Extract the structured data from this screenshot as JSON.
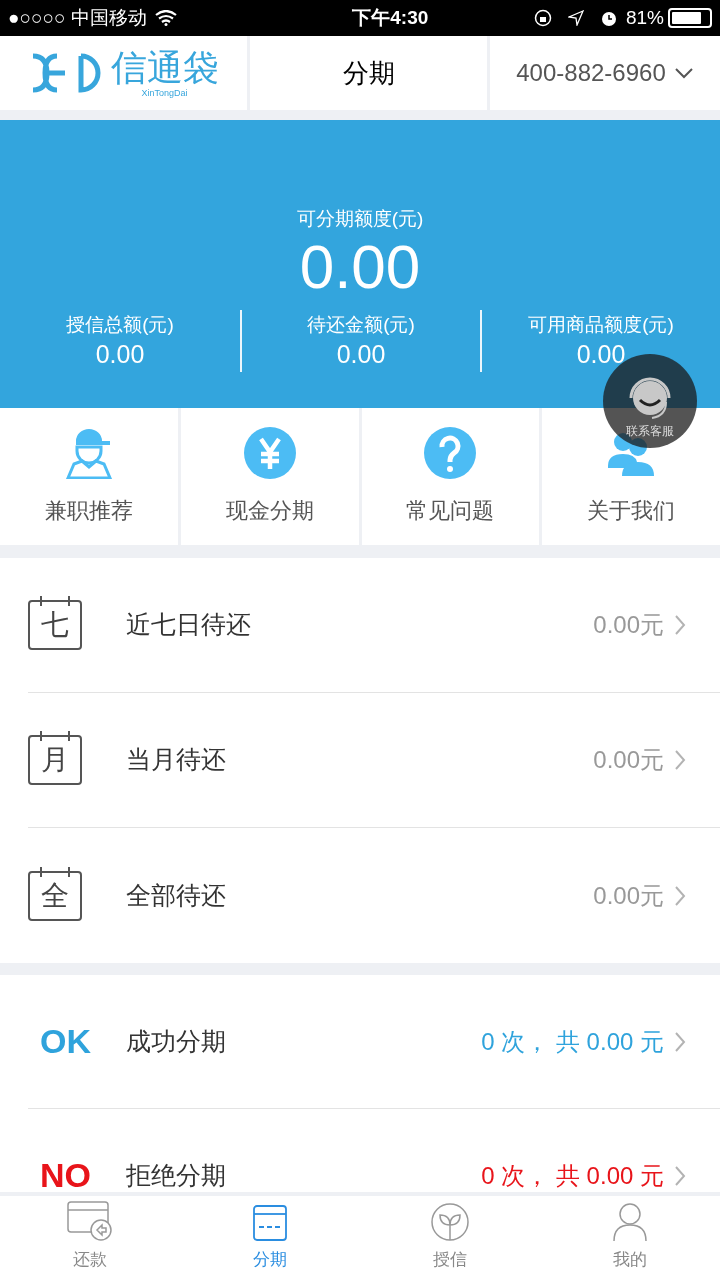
{
  "status_bar": {
    "carrier": "●○○○○ 中国移动",
    "time": "下午4:30",
    "battery": "81%"
  },
  "header": {
    "brand": "信通袋",
    "brand_sub": "XinTongDai",
    "title": "分期",
    "phone": "400-882-6960"
  },
  "summary": {
    "label": "可分期额度(元)",
    "amount": "0.00",
    "stats": [
      {
        "label": "授信总额(元)",
        "value": "0.00"
      },
      {
        "label": "待还金额(元)",
        "value": "0.00"
      },
      {
        "label": "可用商品额度(元)",
        "value": "0.00"
      }
    ]
  },
  "support_button": {
    "label": "联系客服"
  },
  "shortcuts": [
    {
      "kind": "worker",
      "label": "兼职推荐"
    },
    {
      "kind": "yen",
      "label": "现金分期"
    },
    {
      "kind": "question",
      "label": "常见问题"
    },
    {
      "kind": "people",
      "label": "关于我们"
    }
  ],
  "due_rows": [
    {
      "icon_char": "七",
      "label": "近七日待还",
      "value": "0.00元"
    },
    {
      "icon_char": "月",
      "label": "当月待还",
      "value": "0.00元"
    },
    {
      "icon_char": "全",
      "label": "全部待还",
      "value": "0.00元"
    }
  ],
  "result_rows": [
    {
      "badge": "OK",
      "label": "成功分期",
      "value": "0 次， 共 0.00 元",
      "color": "#2fa3dc"
    },
    {
      "badge": "NO",
      "label": "拒绝分期",
      "value": "0 次， 共 0.00 元",
      "color": "#e8141a"
    }
  ],
  "tabs": [
    {
      "kind": "card-return",
      "label": "还款",
      "selected": false
    },
    {
      "kind": "card",
      "label": "分期",
      "selected": true
    },
    {
      "kind": "sprout",
      "label": "授信",
      "selected": false
    },
    {
      "kind": "person",
      "label": "我的",
      "selected": false
    }
  ]
}
